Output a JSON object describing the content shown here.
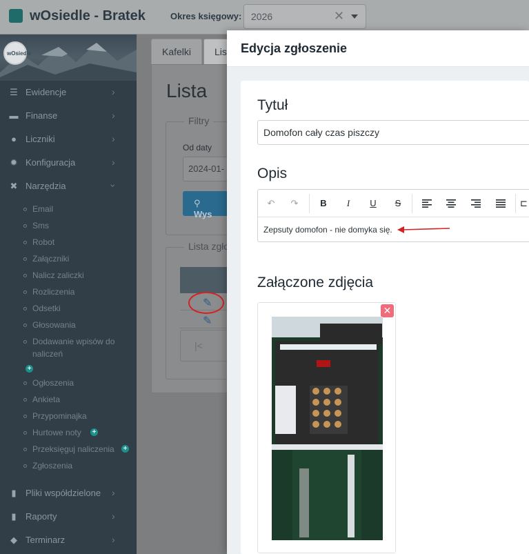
{
  "header": {
    "app_title": "wOsiedle - Bratek",
    "period_label": "Okres księgowy:",
    "period_value": "2026",
    "clear_symbol": "✕"
  },
  "sidebar": {
    "brand": "wOsiedle",
    "sections": [
      {
        "label": "Ewidencje",
        "icon": "list-icon"
      },
      {
        "label": "Finanse",
        "icon": "money-icon"
      },
      {
        "label": "Liczniki",
        "icon": "clock-icon"
      },
      {
        "label": "Konfiguracja",
        "icon": "gear-icon"
      },
      {
        "label": "Narzędzia",
        "icon": "tools-icon"
      }
    ],
    "sub_items": [
      "Email",
      "Sms",
      "Robot",
      "Załączniki",
      "Nalicz zaliczki",
      "Rozliczenia",
      "Odsetki",
      "Głosowania",
      "Dodawanie wpisów do",
      "naliczeń",
      "Ogłoszenia",
      "Ankieta",
      "Przypominajka",
      "Hurtowe noty",
      "Przeksięguj naliczenia",
      "Zgłoszenia"
    ],
    "bottom_sections": [
      {
        "label": "Pliki współdzielone",
        "icon": "file-icon"
      },
      {
        "label": "Raporty",
        "icon": "report-icon"
      },
      {
        "label": "Terminarz",
        "icon": "diamond-icon"
      }
    ]
  },
  "page": {
    "tabs": [
      "Kafelki",
      "Lis"
    ],
    "title": "Lista",
    "filters_legend": "Filtry",
    "date_from_label": "Od daty",
    "date_from_value": "2024-01-",
    "search_button": "Wys",
    "list_legend": "Lista zgło",
    "pager_first": "|<"
  },
  "modal": {
    "title": "Edycja zgłoszenie",
    "title_label": "Tytuł",
    "title_value": "Domofon cały czas piszczy",
    "description_label": "Opis",
    "description_text": "Zepsuty domofon - nie domyka się.",
    "toolbar": {
      "undo": "↶",
      "redo": "↷",
      "bold": "B",
      "italic": "I",
      "underline": "U",
      "strike": "S"
    },
    "photos_label": "Załączone zdjęcia",
    "photo_close": "✕",
    "accent_color": "#f06c7a"
  }
}
